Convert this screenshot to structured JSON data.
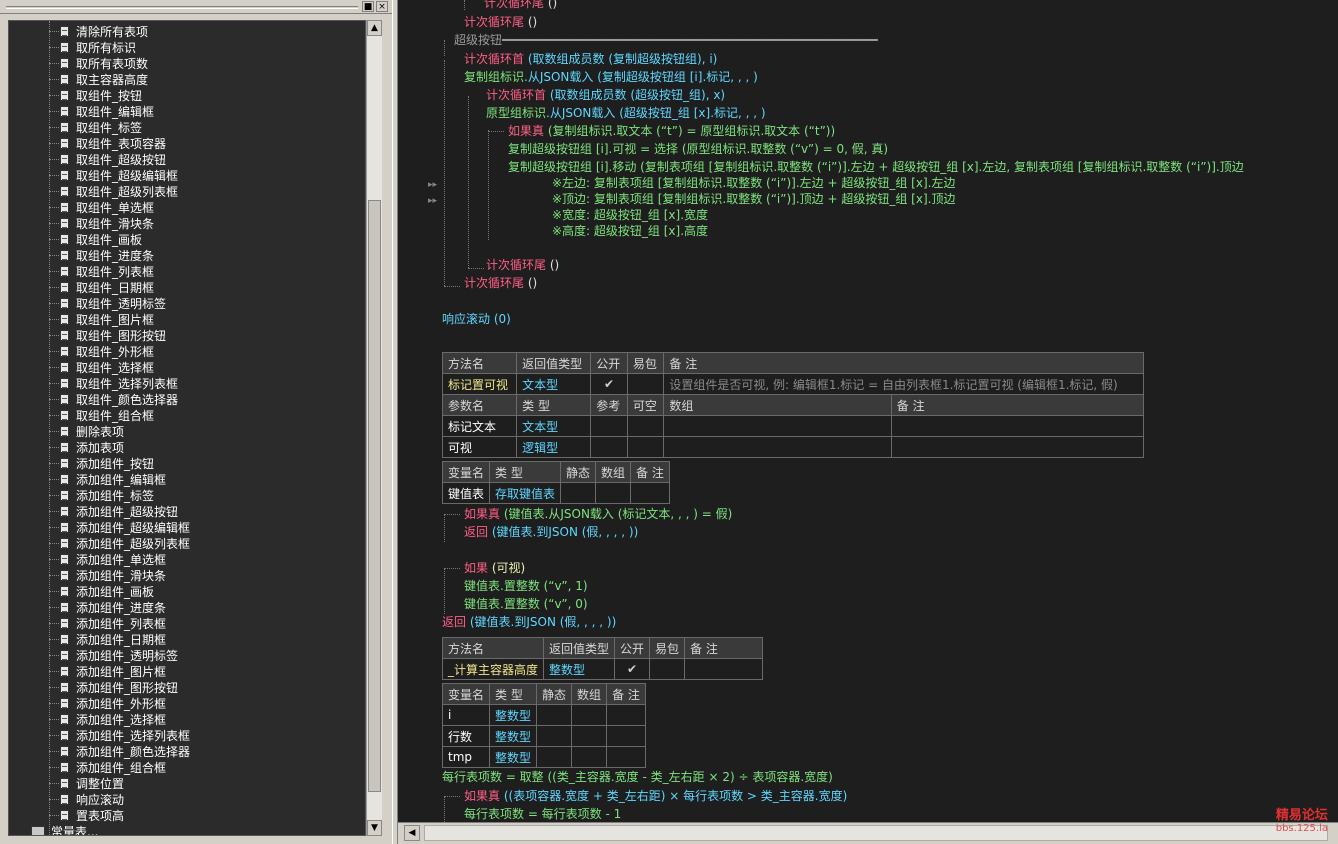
{
  "left_panel": {
    "pin_btn": "■",
    "close_btn": "×",
    "items": [
      "清除所有表项",
      "取所有标识",
      "取所有表项数",
      "取主容器高度",
      "取组件_按钮",
      "取组件_编辑框",
      "取组件_标签",
      "取组件_表项容器",
      "取组件_超级按钮",
      "取组件_超级编辑框",
      "取组件_超级列表框",
      "取组件_单选框",
      "取组件_滑块条",
      "取组件_画板",
      "取组件_进度条",
      "取组件_列表框",
      "取组件_日期框",
      "取组件_透明标签",
      "取组件_图片框",
      "取组件_图形按钮",
      "取组件_外形框",
      "取组件_选择框",
      "取组件_选择列表框",
      "取组件_颜色选择器",
      "取组件_组合框",
      "删除表项",
      "添加表项",
      "添加组件_按钮",
      "添加组件_编辑框",
      "添加组件_标签",
      "添加组件_超级按钮",
      "添加组件_超级编辑框",
      "添加组件_超级列表框",
      "添加组件_单选框",
      "添加组件_滑块条",
      "添加组件_画板",
      "添加组件_进度条",
      "添加组件_列表框",
      "添加组件_日期框",
      "添加组件_透明标签",
      "添加组件_图片框",
      "添加组件_图形按钮",
      "添加组件_外形框",
      "添加组件_选择框",
      "添加组件_选择列表框",
      "添加组件_颜色选择器",
      "添加组件_组合框",
      "调整位置",
      "响应滚动",
      "置表项高"
    ],
    "folder_item": "常量表...",
    "scroll_up": "▲",
    "scroll_down": "▼"
  },
  "code": {
    "l1_loop_end": "计次循环尾",
    "l1_paren": "()",
    "l2_loop_end": "计次循环尾",
    "l2_paren": "()",
    "section": "超级按钮",
    "l4_kw": "计次循环首",
    "l4_rest": "(取数组成员数 (复制超级按钮组), i)",
    "l5_a": "复制组标识",
    "l5_b": ".从JSON载入",
    "l5_c": "(复制超级按钮组 [i].标记, , , )",
    "l6_kw": "计次循环首",
    "l6_rest": "(取数组成员数 (超级按钮_组), x)",
    "l7_a": "原型组标识",
    "l7_b": ".从JSON载入",
    "l7_c": "(超级按钮_组 [x].标记, , , )",
    "l8_kw": "如果真",
    "l8_rest": "(复制组标识.取文本 (“t”) = 原型组标识.取文本 (“t”))",
    "l9": "复制超级按钮组 [i].可视 = 选择 (原型组标识.取整数 (“v”) = 0, 假, 真)",
    "l10": "复制超级按钮组 [i].移动 (复制表项组 [复制组标识.取整数 (“i”)].左边 + 超级按钮_组 [x].左边, 复制表项组 [复制组标识.取整数 (“i”)].顶边",
    "l11": "※左边: 复制表项组 [复制组标识.取整数 (“i”)].左边 + 超级按钮_组 [x].左边",
    "l12": "※顶边: 复制表项组 [复制组标识.取整数 (“i”)].顶边 + 超级按钮_组 [x].顶边",
    "l13": "※宽度: 超级按钮_组 [x].宽度",
    "l14": "※高度: 超级按钮_组 [x].高度",
    "l15_kw": "计次循环尾",
    "l15_p": "()",
    "l16_kw": "计次循环尾",
    "l16_p": "()",
    "l17": "响应滚动 (0)",
    "l18_kw": "如果真",
    "l18_rest": "(键值表.从JSON载入 (标记文本, , , ) = 假)",
    "l19_kw": "返回",
    "l19_rest": "(键值表.到JSON (假, , , , ))",
    "l20_kw": "如果",
    "l20_rest": "(可视)",
    "l21": "键值表.置整数 (“v”, 1)",
    "l22": "键值表.置整数 (“v”, 0)",
    "l23_kw": "返回",
    "l23_rest": "(键值表.到JSON (假, , , , ))",
    "l24": "每行表项数 = 取整 ((类_主容器.宽度 - 类_左右距 × 2) ÷ 表项容器.宽度)",
    "l25_kw": "如果真",
    "l25_rest": "((表项容器.宽度 + 类_左右距) × 每行表项数 > 类_主容器.宽度)",
    "l26": "每行表项数 = 每行表项数 - 1"
  },
  "table1": {
    "hdr": [
      "方法名",
      "返回值类型",
      "公开",
      "易包",
      "备 注"
    ],
    "row": [
      "标记置可视",
      "文本型",
      "✔",
      "",
      "设置组件是否可视, 例: 编辑框1.标记 = 自由列表框1.标记置可视 (编辑框1.标记, 假)"
    ],
    "phdr": [
      "参数名",
      "类 型",
      "参考",
      "可空",
      "数组",
      "备 注"
    ],
    "p1": [
      "标记文本",
      "文本型"
    ],
    "p2": [
      "可视",
      "逻辑型"
    ]
  },
  "table2": {
    "hdr": [
      "变量名",
      "类 型",
      "静态",
      "数组",
      "备 注"
    ],
    "row": [
      "键值表",
      "存取键值表"
    ]
  },
  "table3": {
    "hdr": [
      "方法名",
      "返回值类型",
      "公开",
      "易包",
      "备 注"
    ],
    "row": [
      "_计算主容器高度",
      "整数型",
      "✔"
    ]
  },
  "table4": {
    "hdr": [
      "变量名",
      "类 型",
      "静态",
      "数组",
      "备 注"
    ],
    "rows": [
      [
        "i",
        "整数型"
      ],
      [
        "行数",
        "整数型"
      ],
      [
        "tmp",
        "整数型"
      ]
    ]
  },
  "watermark": {
    "name": "精易论坛",
    "url": "bbs.125.la"
  },
  "hscroll": {
    "left": "◀",
    "right": "▶"
  }
}
